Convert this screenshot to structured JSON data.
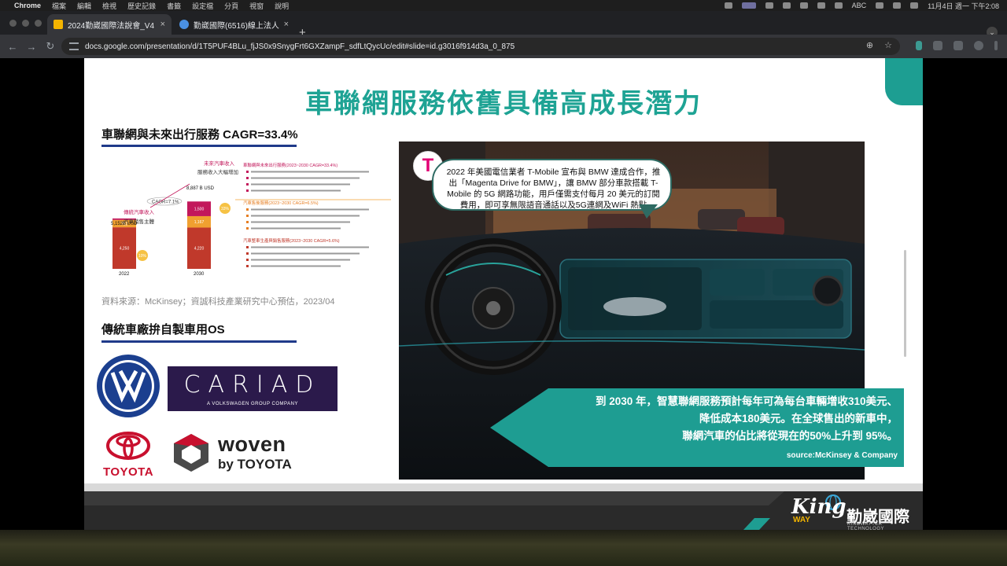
{
  "menubar": {
    "app_name": "Chrome",
    "items": [
      "檔案",
      "編輯",
      "檢視",
      "歷史記錄",
      "書籤",
      "設定檔",
      "分頁",
      "視窗",
      "說明"
    ],
    "clock": "11月4日 週一 下午2:08",
    "input_method": "ABC"
  },
  "browser": {
    "tabs": [
      {
        "title": "2024勤崴國際法說會_V4 - Go",
        "favicon_color": "#f4b400"
      },
      {
        "title": "勤崴國際(6516)線上法人說明會",
        "favicon_color": "#4a90e2"
      }
    ],
    "url": "docs.google.com/presentation/d/1T5PUF4BLu_fjJS0x9SnygFrt6GXZampF_sdfLtQycUc/edit#slide=id.g3016f914d3a_0_875"
  },
  "slide": {
    "title": "車聯網服務依舊具備高成長潛力",
    "section1_heading": "車聯網與未來出行服務 CAGR=33.4%",
    "source_note": "資料來源：McKinsey；資誠科技產業研究中心預估，2023/04",
    "section2_heading": "傳統車廠拚自製車用OS",
    "bubble_text": "2022 年美國電信業者 T-Mobile 宣布與 BMW 達成合作，推出「Magenta Drive for BMW」，讓 BMW 部分車款搭載 T-Mobile 的 5G 網路功能，用戶僅需支付每月 20 美元的訂閱費用，即可享無限語音通話以及5G連網及WiFi 熱點",
    "bubble_logo": "T",
    "callout_lines": [
      "到 2030 年，智慧聯網服務預計每年可為每台車輛增收310美元、",
      "降低成本180美元。在全球售出的新車中，",
      "聯網汽車的佔比將從現在的50%上升到 95%。"
    ],
    "callout_source": "source:McKinsey & Company",
    "logos": {
      "cariad": "CARIAD",
      "cariad_sub": "A VOLKSWAGEN GROUP COMPANY",
      "toyota": "TOYOTA",
      "woven": "woven",
      "woven_by": "by TOYOTA",
      "vw_letters": "VW"
    },
    "footer": {
      "king": "King",
      "way": "WAY",
      "company_cn": "勤崴國際",
      "company_en": "KINGWAYTEK TECHNOLOGY"
    }
  },
  "chart_data": {
    "type": "bar",
    "categories": [
      "2022",
      "2030"
    ],
    "series": [
      {
        "name": "汽車銷售主體",
        "values": [
          4250,
          4220
        ],
        "color": "#c0392b"
      },
      {
        "name": "汽車售後服務",
        "values": [
          752,
          1167
        ],
        "color": "#f0a030"
      },
      {
        "name": "車聯網與未來出行服務",
        "values": [
          150,
          1500
        ],
        "color": "#c2185b"
      }
    ],
    "totals": [
      "5,152B USD",
      "8,887 B USD"
    ],
    "labels": {
      "left_title": "傳統汽車收入",
      "left_sub": "汽車銷售主體",
      "right_title": "未來汽車收入",
      "right_sub": "服務收入大幅增加",
      "cagr_main": "CAGR=7.1%",
      "badge_a": "33%",
      "badge_b": "10%"
    },
    "right_blocks": [
      {
        "heading": "車聯網與未來出行服務(2023~2030 CAGR=33.4%)",
        "color": "#c2185b"
      },
      {
        "heading": "汽車售後服務(2023~2030 CAGR=6.5%)",
        "color": "#e67e22"
      },
      {
        "heading": "汽車整車生產與銷售服務(2023~2030 CAGR=5.6%)",
        "color": "#c0392b"
      }
    ],
    "ylim": [
      0,
      9000
    ]
  }
}
